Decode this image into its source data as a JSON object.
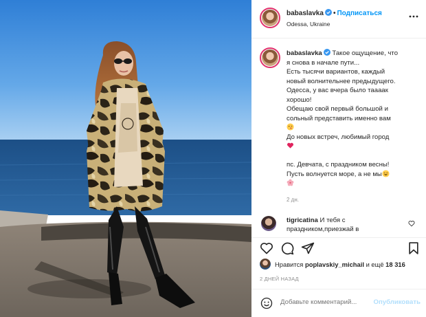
{
  "post": {
    "username": "babaslavka",
    "follow_label": "Подписаться",
    "location": "Odessa, Ukraine"
  },
  "caption": {
    "username": "babaslavka",
    "lines": [
      "Такое ощущение, что",
      "я снова в начале пути...",
      "Есть тысячи вариантов, каждый",
      "новый волнительнее предыдущего.",
      "Одесса, у вас вчера было таааак",
      "хорошо!",
      "Обещаю свой первый большой и",
      "сольный представить именно вам",
      "До новых встреч, любимый город",
      "пс. Девчата, с праздником весны!",
      "Пусть волнуется море, а не мы"
    ],
    "time": "2 дн."
  },
  "comment": {
    "username": "tigricatina",
    "text_line1": "И тебя с",
    "text_line2": "праздником,приезжай в"
  },
  "likes": {
    "prefix": "Нравится",
    "user": "poplavskiy_michail",
    "and": "и ещё",
    "count": "18 316"
  },
  "timestamp": "2 ДНЕЙ НАЗАД",
  "add_comment": {
    "placeholder": "Добавьте комментарий...",
    "publish_label": "Опубликовать"
  },
  "icons": {
    "header_more": "more-horizontal-icon",
    "like": "heart-icon",
    "comment": "comment-icon",
    "share": "paper-plane-icon",
    "save": "bookmark-icon",
    "emoji": "smiley-icon",
    "verified": "verified-badge-icon"
  },
  "colors": {
    "accent": "#0095f6",
    "verified": "#3897f0",
    "story_ring": "#e1306c",
    "heart_emoji": "#e0245e",
    "muted": "#8e8e8e"
  }
}
